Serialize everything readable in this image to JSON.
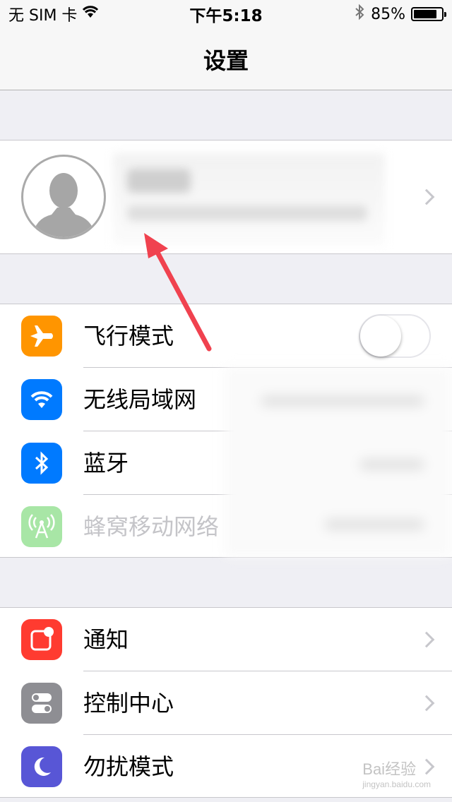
{
  "status_bar": {
    "carrier": "无 SIM 卡",
    "time": "下午5:18",
    "battery_percent": "85%",
    "battery_level": 0.85,
    "icons": [
      "wifi-icon",
      "bluetooth-icon",
      "battery-icon"
    ]
  },
  "nav": {
    "title": "设置"
  },
  "groups": {
    "connectivity": [
      {
        "label": "飞行模式",
        "icon": "airplane-icon",
        "color": "#ff9500",
        "control": "toggle",
        "toggle_on": false
      },
      {
        "label": "无线局域网",
        "icon": "wifi-icon",
        "color": "#007aff"
      },
      {
        "label": "蓝牙",
        "icon": "bluetooth-icon",
        "color": "#007aff"
      },
      {
        "label": "蜂窝移动网络",
        "icon": "cellular-icon",
        "color": "#a8e6a6",
        "disabled": true
      }
    ],
    "system": [
      {
        "label": "通知",
        "icon": "notifications-icon",
        "color": "#ff3b30"
      },
      {
        "label": "控制中心",
        "icon": "control-center-icon",
        "color": "#8e8e93"
      },
      {
        "label": "勿扰模式",
        "icon": "moon-icon",
        "color": "#5856d6"
      }
    ]
  },
  "colors": {
    "background": "#efeff4",
    "annotation_arrow": "#f0424f"
  },
  "watermark": {
    "brand": "Bai经验",
    "domain": "jingyan.baidu.com"
  }
}
